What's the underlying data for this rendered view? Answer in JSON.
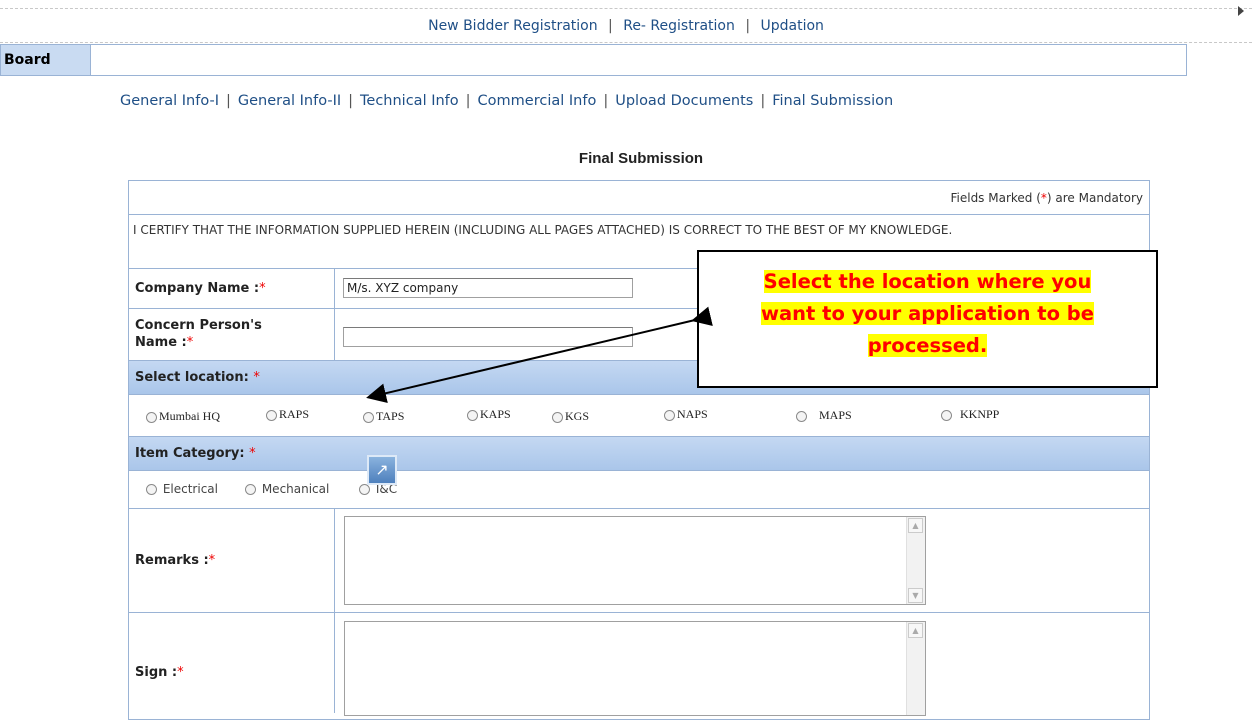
{
  "top_nav": {
    "new_bidder": "New Bidder Registration",
    "re_registration": "Re- Registration",
    "updation": "Updation",
    "sep": "|"
  },
  "board": {
    "label": "Board"
  },
  "tabs": {
    "sep": "|",
    "items": [
      "General Info-I",
      "General Info-II",
      "Technical Info",
      "Commercial Info",
      "Upload Documents",
      "Final Submission"
    ]
  },
  "section_title": "Final Submission",
  "form": {
    "mandatory_prefix": "Fields Marked (",
    "mandatory_star": "*",
    "mandatory_suffix": ") are Mandatory",
    "certify_text": "I CERTIFY THAT THE INFORMATION SUPPLIED HEREIN (INCLUDING ALL PAGES ATTACHED) IS CORRECT TO THE BEST OF MY KNOWLEDGE.",
    "company_label": "Company Name :",
    "company_value": "M/s. XYZ company",
    "concern_label_line1": "Concern Person's",
    "concern_label_line2": "Name :",
    "concern_value": "",
    "required_star": "*",
    "location_header": "Select location: ",
    "locations": [
      "Mumbai HQ",
      "RAPS",
      "TAPS",
      "KAPS",
      "KGS",
      "NAPS",
      "MAPS",
      "KKNPP"
    ],
    "category_header": "Item Category: ",
    "categories": [
      "Electrical",
      "Mechanical",
      "I&C"
    ],
    "remarks_label": "Remarks :",
    "sign_label": "Sign :"
  },
  "callout": {
    "line1": "Select the location where you",
    "line2": "want to your application to be",
    "line3": "processed."
  },
  "colors": {
    "link": "#1f4f86",
    "header_bg": "#aac6ea",
    "callout_text": "#ff0000",
    "callout_highlight": "#ffff00",
    "required": "#ee0000"
  },
  "icons": {
    "expand": "expand-icon",
    "play": "play-icon"
  }
}
